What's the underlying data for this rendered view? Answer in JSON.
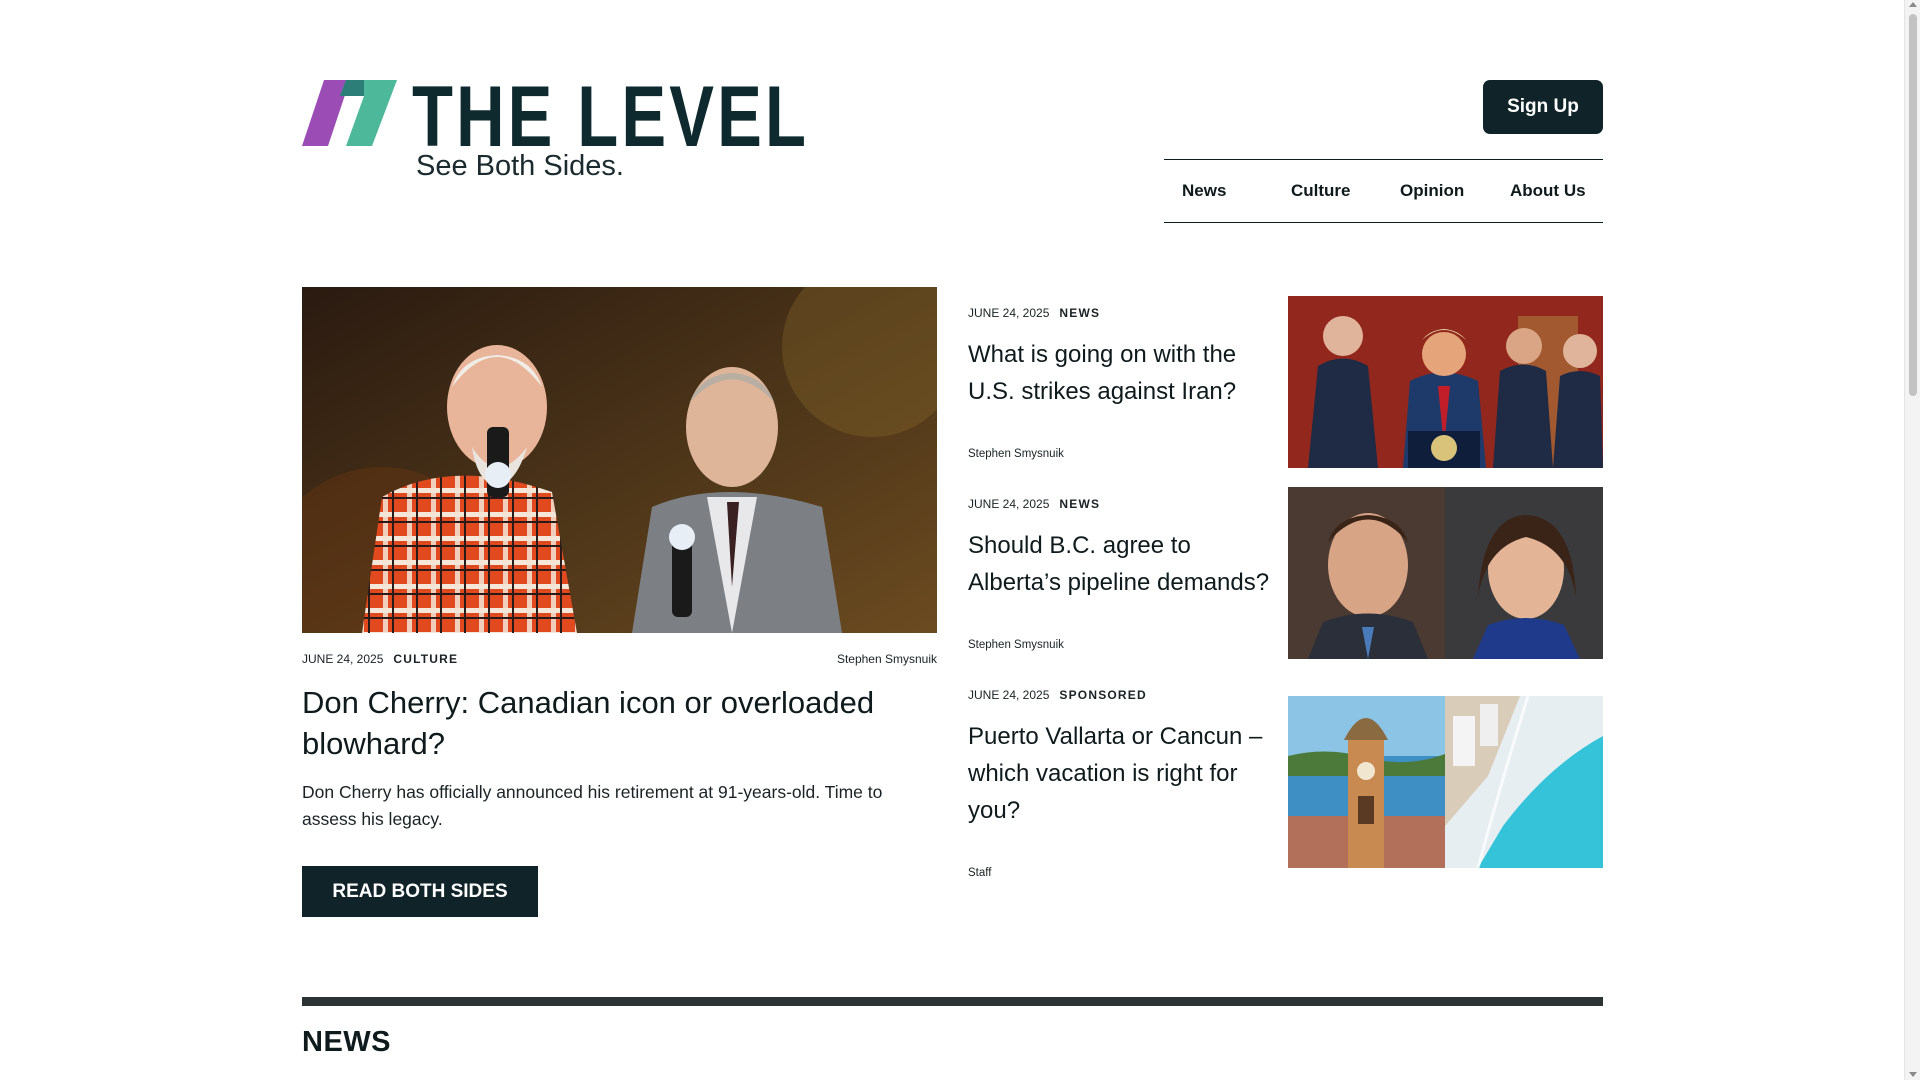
{
  "header": {
    "logo_text": "THE LEVEL",
    "tagline": "See Both Sides.",
    "signup_label": "Sign Up",
    "nav": [
      "News",
      "Culture",
      "Opinion",
      "About Us"
    ]
  },
  "colors": {
    "logo_purple": "#9b4db5",
    "logo_green": "#4db89a",
    "brand_dark": "#0f2329"
  },
  "featured": {
    "date": "JUNE 24, 2025",
    "category": "CULTURE",
    "author": "Stephen Smysnuik",
    "title": "Don Cherry: Canadian icon or overloaded blowhard?",
    "excerpt": "Don Cherry has officially announced his retirement at 91-years-old. Time to assess his legacy.",
    "cta": "READ BOTH SIDES"
  },
  "side_articles": [
    {
      "date": "JUNE 24, 2025",
      "category": "NEWS",
      "title": "What is going on with the U.S. strikes against Iran?",
      "author": "Stephen Smysnuik"
    },
    {
      "date": "JUNE 24, 2025",
      "category": "NEWS",
      "title": "Should B.C. agree to Alberta’s pipeline demands?",
      "author": "Stephen Smysnuik"
    },
    {
      "date": "JUNE 24, 2025",
      "category": "SPONSORED",
      "title": "Puerto Vallarta or Cancun –  which vacation is right for you?",
      "author": "Staff"
    }
  ],
  "section": {
    "title": "NEWS"
  }
}
